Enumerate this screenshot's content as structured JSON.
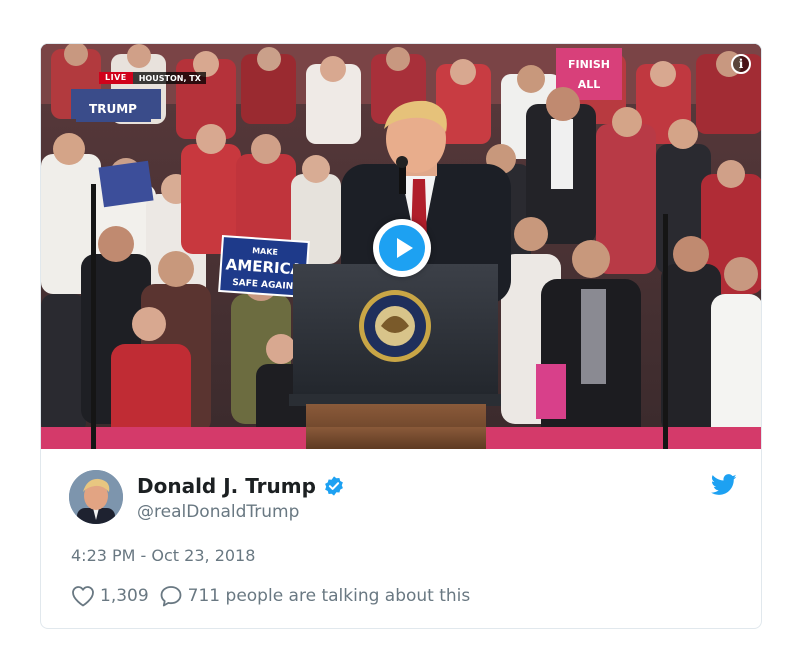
{
  "video": {
    "live_label": "LIVE",
    "location": "HOUSTON, TX",
    "info_label": "i",
    "sign_text": [
      "MAKE",
      "AMERICA",
      "SAFE AGAIN"
    ],
    "banner_text": [
      "FINISH",
      "ALL"
    ],
    "shirt_text": "TRUMP",
    "seal_text": "SEAL OF THE PRESIDENT OF THE UNITED STATES"
  },
  "tweet": {
    "name": "Donald J. Trump",
    "handle": "@realDonaldTrump",
    "timestamp": "4:23 PM - Oct 23, 2018",
    "likes": "1,309",
    "conversation": "711 people are talking about this"
  },
  "colors": {
    "accent": "#1da1f2",
    "text_primary": "#1c2022",
    "text_secondary": "#697882",
    "border": "#e1e8ed",
    "live_red": "#d0021b"
  },
  "icons": {
    "verified": "verified-badge-icon",
    "twitter": "twitter-bird-icon",
    "like": "heart-icon",
    "reply": "speech-bubble-icon",
    "play": "play-icon",
    "info": "info-icon"
  }
}
